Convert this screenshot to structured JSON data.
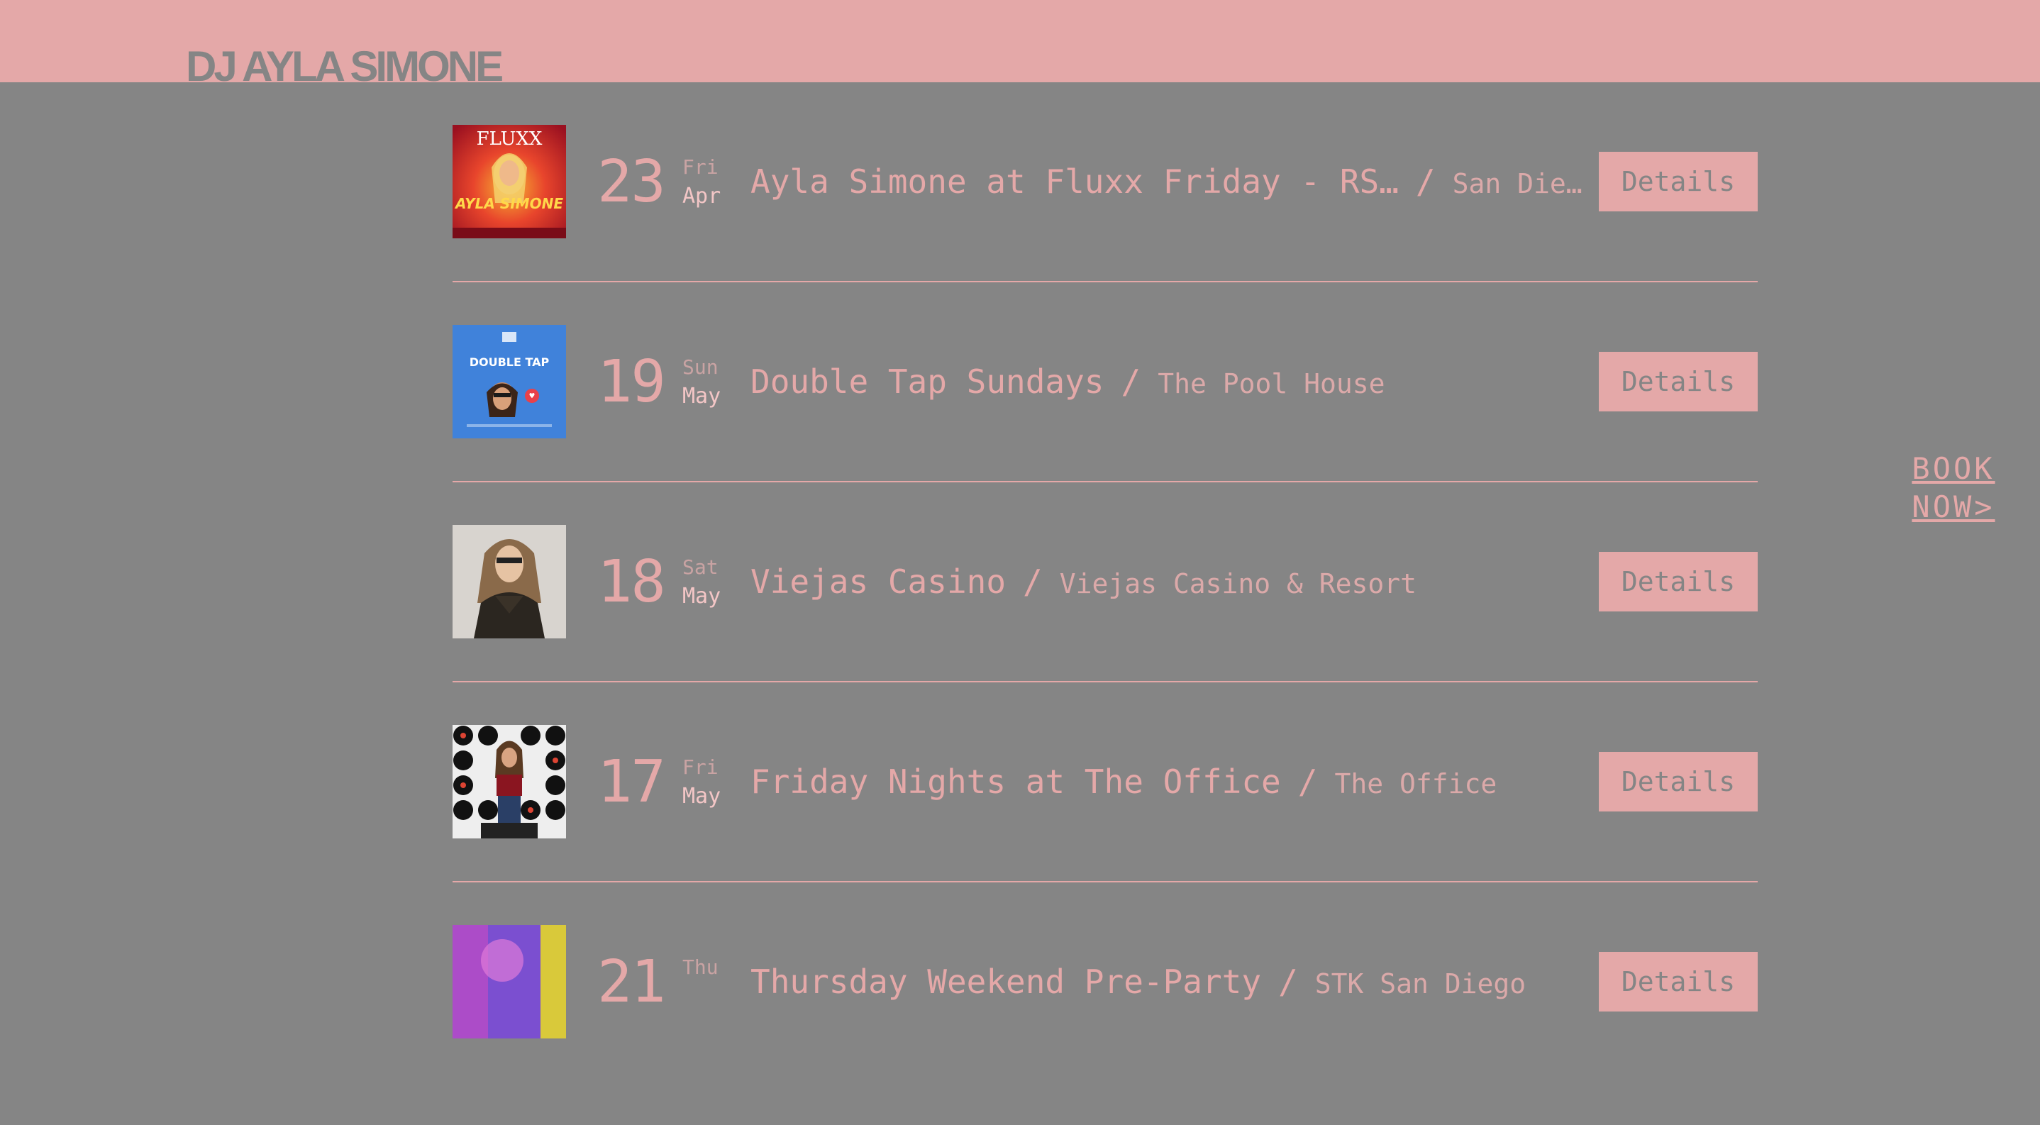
{
  "site": {
    "logo": "DJ AYLA SIMONE"
  },
  "book_now": {
    "line1": "BOOK",
    "line2": "NOW>"
  },
  "events": [
    {
      "day": "23",
      "weekday": "Fri",
      "month": "Apr",
      "title": "Ayla Simone at Fluxx Friday - RS…",
      "venue": "San Die…",
      "button": "Details",
      "flyer_text": "FLUXX",
      "flyer_name": "AYLA SIMONE"
    },
    {
      "day": "19",
      "weekday": "Sun",
      "month": "May",
      "title": "Double Tap Sundays",
      "venue": "The Pool House",
      "button": "Details",
      "flyer_text": "DOUBLE TAP"
    },
    {
      "day": "18",
      "weekday": "Sat",
      "month": "May",
      "title": "Viejas Casino",
      "venue": "Viejas Casino & Resort",
      "button": "Details"
    },
    {
      "day": "17",
      "weekday": "Fri",
      "month": "May",
      "title": "Friday Nights at The Office",
      "venue": "The Office",
      "button": "Details"
    },
    {
      "day": "21",
      "weekday": "Thu",
      "month": "",
      "title": "Thursday Weekend Pre-Party",
      "venue": "STK San Diego",
      "button": "Details"
    }
  ],
  "colors": {
    "background": "#858585",
    "accent": "#e4a8a8"
  }
}
